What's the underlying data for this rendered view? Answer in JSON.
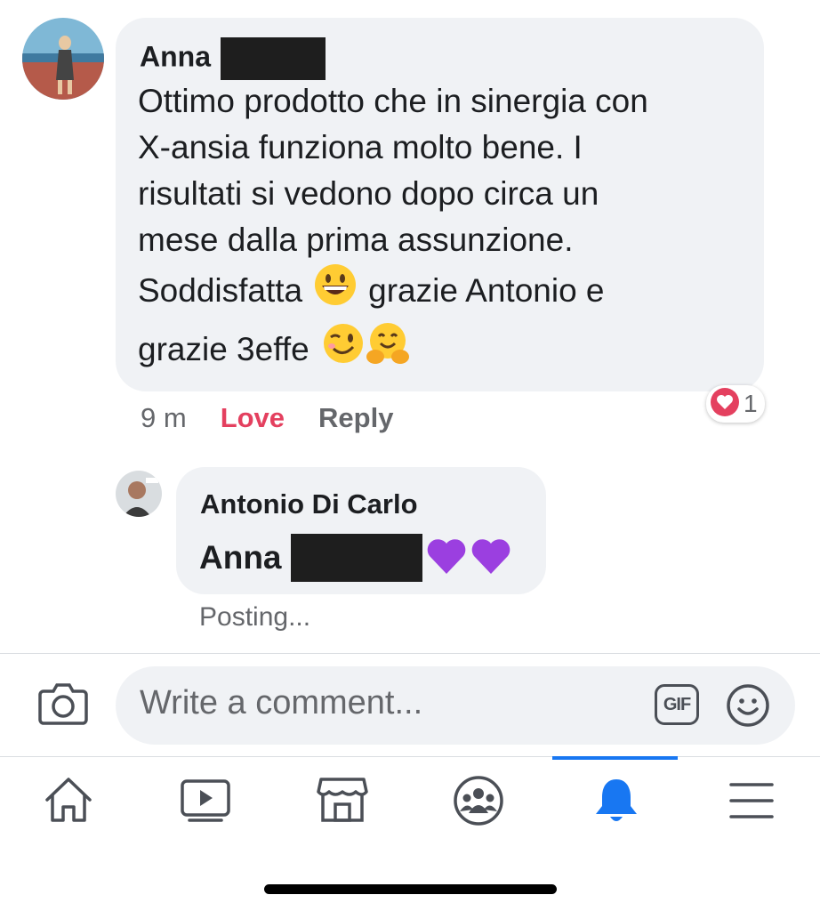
{
  "comment1": {
    "author": "Anna",
    "text_lines": [
      "Ottimo prodotto che in sinergia con",
      "X-ansia funziona molto bene. I",
      "risultati si vedono dopo circa un",
      "mese dalla prima assunzione."
    ],
    "line5_a": "Soddisfatta",
    "line5_b": "grazie Antonio e",
    "line6": "grazie 3effe",
    "timestamp": "9 m",
    "love_label": "Love",
    "reply_label": "Reply",
    "reaction_count": "1",
    "emojis": [
      "grinning-face",
      "winking-face",
      "hugging-face"
    ]
  },
  "reply1": {
    "author": "Antonio Di Carlo",
    "mention": "Anna",
    "emojis": [
      "purple-heart",
      "purple-heart"
    ],
    "status": "Posting..."
  },
  "composer": {
    "placeholder": "Write a comment...",
    "gif_label": "GIF"
  },
  "bottom_nav": {
    "items": [
      "home-icon",
      "watch-icon",
      "marketplace-icon",
      "groups-icon",
      "notifications-icon",
      "menu-icon"
    ],
    "active": "notifications-icon",
    "active_color": "#1877f2"
  },
  "colors": {
    "love": "#e4405f",
    "bubble": "#f0f2f5",
    "purple_heart": "#9b3fe0"
  }
}
